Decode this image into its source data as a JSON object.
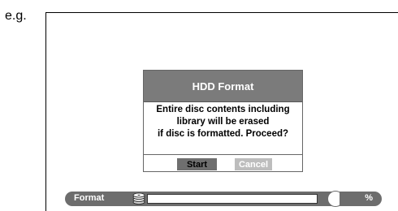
{
  "example_label": "e.g.",
  "dialog": {
    "title": "HDD Format",
    "message_lines": [
      "Entire disc contents including",
      "library will be erased",
      "if disc is formatted. Proceed?"
    ],
    "start_label": "Start",
    "cancel_label": "Cancel"
  },
  "status_bar": {
    "label": "Format",
    "icon": "disc-stack-icon",
    "progress": 0,
    "percent_symbol": "%"
  },
  "colors": {
    "title_bar": "#7b7b7b",
    "status_bar": "#6d6d6d",
    "start_button": "#6f6f6f",
    "cancel_button": "#bdbdbd"
  }
}
